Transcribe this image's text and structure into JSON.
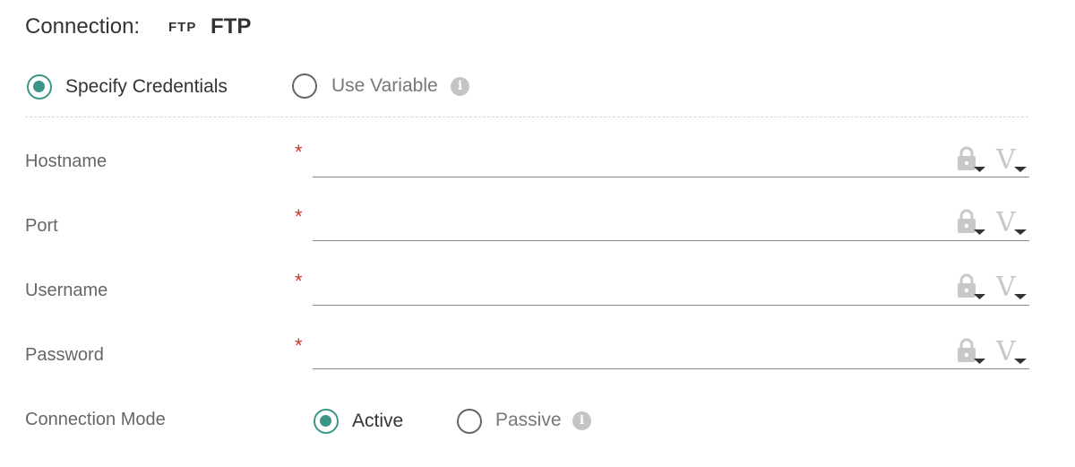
{
  "header": {
    "label": "Connection:",
    "badge": "FTP",
    "name": "FTP"
  },
  "credential_mode": {
    "options": [
      {
        "label": "Specify Credentials",
        "selected": true
      },
      {
        "label": "Use Variable",
        "selected": false,
        "has_info": true
      }
    ]
  },
  "fields": [
    {
      "label": "Hostname",
      "required": "*",
      "value": ""
    },
    {
      "label": "Port",
      "required": "*",
      "value": ""
    },
    {
      "label": "Username",
      "required": "*",
      "value": ""
    },
    {
      "label": "Password",
      "required": "*",
      "value": ""
    }
  ],
  "field_icons": {
    "lock": "lock-dropdown-icon",
    "variable": "variable-dropdown-icon",
    "variable_glyph": "V",
    "info_glyph": "i"
  },
  "connection_mode": {
    "label": "Connection Mode",
    "options": [
      {
        "label": "Active",
        "selected": true
      },
      {
        "label": "Passive",
        "selected": false,
        "has_info": true
      }
    ]
  },
  "colors": {
    "accent": "#3b9687",
    "required": "#c0392b",
    "icon_muted": "#c8c8c8"
  }
}
